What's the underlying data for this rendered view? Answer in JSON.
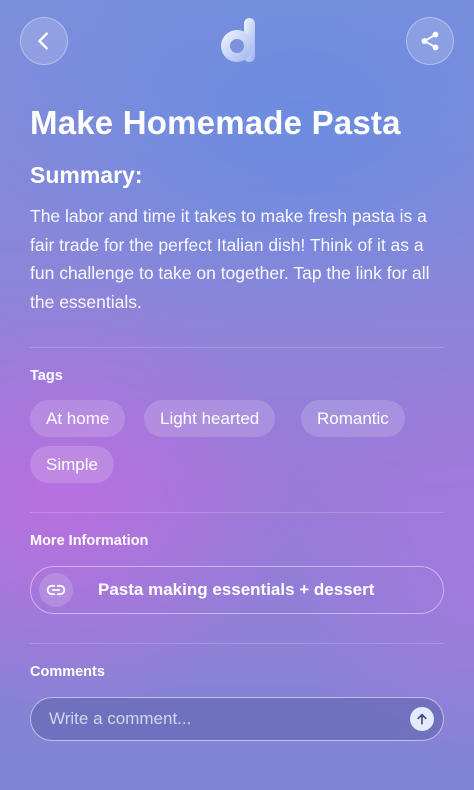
{
  "header": {
    "back_icon": "chevron-left-icon",
    "logo_icon": "d-logo-icon",
    "share_icon": "share-icon"
  },
  "title": "Make Homemade Pasta",
  "summary": {
    "heading": "Summary:",
    "text": "The labor and time it takes to make fresh pasta is a fair trade for the perfect Italian dish! Think of it as a fun challenge to take on together. Tap the link for all the essentials."
  },
  "tags": {
    "heading": "Tags",
    "items": [
      "At home",
      "Light hearted",
      "Romantic",
      "Simple"
    ]
  },
  "more_info": {
    "heading": "More Information",
    "link_label": "Pasta making essentials + dessert",
    "link_icon": "link-icon"
  },
  "comments": {
    "heading": "Comments",
    "placeholder": "Write a comment...",
    "send_icon": "arrow-up-icon"
  }
}
